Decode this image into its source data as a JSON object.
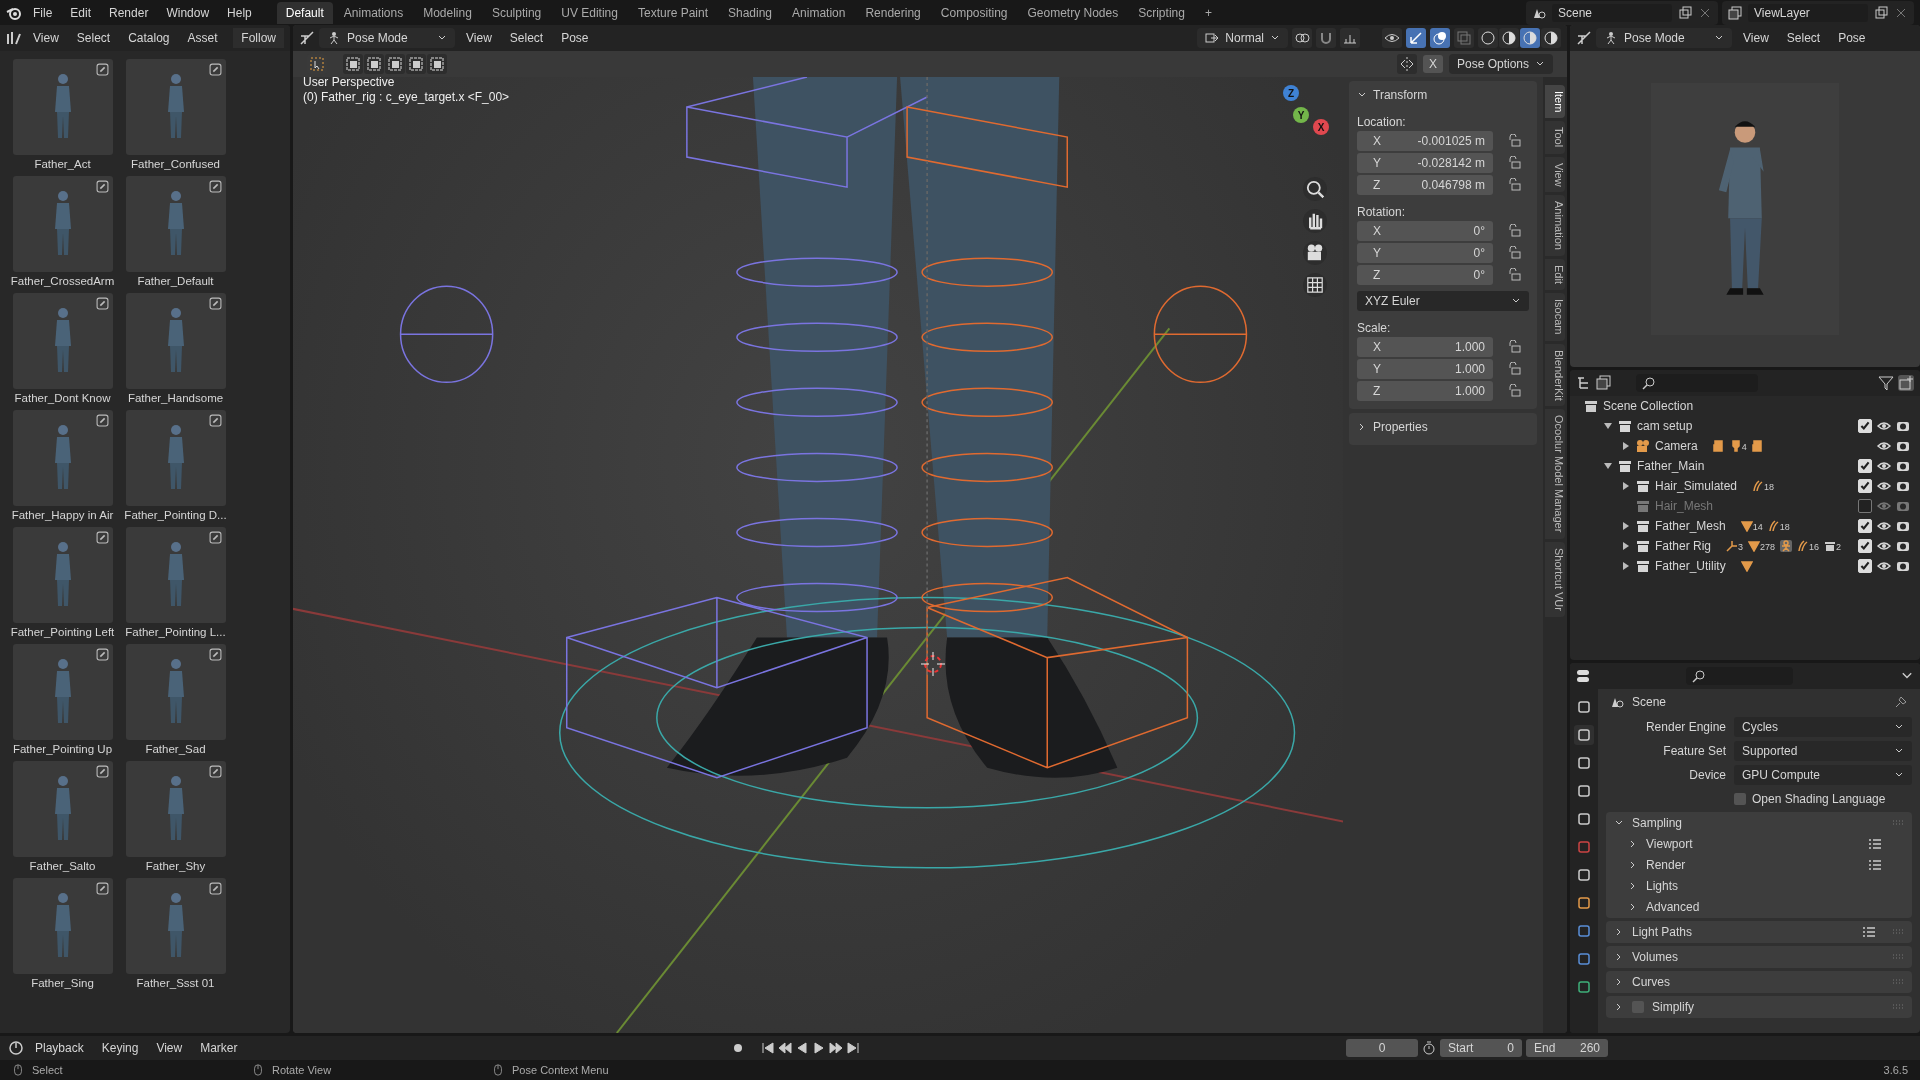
{
  "menu_bar": {
    "items": [
      "File",
      "Edit",
      "Render",
      "Window",
      "Help"
    ]
  },
  "workspace_tabs": [
    {
      "label": "Default",
      "selected": true
    },
    {
      "label": "Animations",
      "selected": false
    },
    {
      "label": "Modeling",
      "selected": false
    },
    {
      "label": "Sculpting",
      "selected": false
    },
    {
      "label": "UV Editing",
      "selected": false
    },
    {
      "label": "Texture Paint",
      "selected": false
    },
    {
      "label": "Shading",
      "selected": false
    },
    {
      "label": "Animation",
      "selected": false
    },
    {
      "label": "Rendering",
      "selected": false
    },
    {
      "label": "Compositing",
      "selected": false
    },
    {
      "label": "Geometry Nodes",
      "selected": false
    },
    {
      "label": "Scripting",
      "selected": false
    },
    {
      "label": "+",
      "selected": false
    }
  ],
  "scene": {
    "name": "Scene"
  },
  "view_layer": {
    "name": "ViewLayer"
  },
  "asset_browser": {
    "menus": [
      "View",
      "Select",
      "Catalog",
      "Asset"
    ],
    "follow": "Follow",
    "assets": [
      {
        "name": "Father_Act"
      },
      {
        "name": "Father_Confused"
      },
      {
        "name": "Father_CrossedArm"
      },
      {
        "name": "Father_Default"
      },
      {
        "name": "Father_Dont Know"
      },
      {
        "name": "Father_Handsome"
      },
      {
        "name": "Father_Happy in Air"
      },
      {
        "name": "Father_Pointing D..."
      },
      {
        "name": "Father_Pointing Left"
      },
      {
        "name": "Father_Pointing L..."
      },
      {
        "name": "Father_Pointing Up"
      },
      {
        "name": "Father_Sad"
      },
      {
        "name": "Father_Salto"
      },
      {
        "name": "Father_Shy"
      },
      {
        "name": "Father_Sing"
      },
      {
        "name": "Father_Ssst 01"
      }
    ]
  },
  "viewport": {
    "mode": "Pose Mode",
    "menus": [
      "View",
      "Select",
      "Pose"
    ],
    "orientation": "Normal",
    "xray": "X",
    "pose_options": "Pose Options",
    "view_name": "User Perspective",
    "active_info": "(0) Father_rig : c_eye_target.x <F_00>",
    "gizmo_axes": [
      "X",
      "Y",
      "Z"
    ],
    "shading_modes": [
      {
        "selected": false
      },
      {
        "selected": false
      },
      {
        "selected": true
      },
      {
        "selected": false
      }
    ]
  },
  "sidebar": {
    "tabs": [
      {
        "label": "Item",
        "selected": true
      },
      {
        "label": "Tool",
        "selected": false
      },
      {
        "label": "View",
        "selected": false
      },
      {
        "label": "Animation",
        "selected": false
      },
      {
        "label": "Edit",
        "selected": false
      },
      {
        "label": "Isocam",
        "selected": false
      },
      {
        "label": "BlenderKit",
        "selected": false
      },
      {
        "label": "Ococlur Model Manager",
        "selected": false
      },
      {
        "label": "Shortcut VUr",
        "selected": false
      }
    ],
    "transform": {
      "title": "Transform",
      "expanded": true,
      "groups": [
        {
          "label": "Location:",
          "fields": [
            {
              "axis": "X",
              "value": "-0.001025 m"
            },
            {
              "axis": "Y",
              "value": "-0.028142 m"
            },
            {
              "axis": "Z",
              "value": "0.046798 m"
            }
          ]
        },
        {
          "label": "Rotation:",
          "fields": [
            {
              "axis": "X",
              "value": "0°"
            },
            {
              "axis": "Y",
              "value": "0°"
            },
            {
              "axis": "Z",
              "value": "0°"
            }
          ]
        },
        {
          "label": "Scale:",
          "fields": [
            {
              "axis": "X",
              "value": "1.000"
            },
            {
              "axis": "Y",
              "value": "1.000"
            },
            {
              "axis": "Z",
              "value": "1.000"
            }
          ]
        }
      ],
      "rotation_mode": "XYZ Euler"
    },
    "properties": {
      "title": "Properties",
      "expanded": false
    }
  },
  "preview": {
    "mode": "Pose Mode",
    "menus": [
      "View",
      "Select",
      "Pose"
    ]
  },
  "outliner": {
    "root": "Scene Collection",
    "items": [
      {
        "name": "cam setup",
        "kind": "collection",
        "expanded": true,
        "checked": true,
        "children": [
          {
            "name": "Camera",
            "kind": "object",
            "expanded": false,
            "badges": [
              {
                "kind": "camera"
              },
              {
                "kind": "light",
                "count": "4"
              },
              {
                "kind": "camera"
              }
            ]
          }
        ]
      },
      {
        "name": "Father_Main",
        "kind": "collection",
        "expanded": true,
        "checked": true,
        "children": [
          {
            "name": "Hair_Simulated",
            "kind": "collection",
            "expanded": false,
            "checked": true,
            "badges": [
              {
                "kind": "hair",
                "count": "18"
              }
            ]
          },
          {
            "name": "Hair_Mesh",
            "kind": "collection",
            "checked": false
          },
          {
            "name": "Father_Mesh",
            "kind": "collection",
            "expanded": false,
            "checked": true,
            "badges": [
              {
                "kind": "mesh",
                "count": "14"
              },
              {
                "kind": "hair",
                "count": "18"
              }
            ]
          },
          {
            "name": "Father Rig",
            "kind": "collection",
            "expanded": false,
            "checked": true,
            "badges": [
              {
                "kind": "armature",
                "count": "3"
              },
              {
                "kind": "mesh",
                "count": "278"
              },
              {
                "kind": "pose"
              },
              {
                "kind": "hair",
                "count": "16"
              },
              {
                "kind": "collection",
                "count": "2"
              }
            ]
          },
          {
            "name": "Father_Utility",
            "kind": "collection",
            "expanded": false,
            "checked": true,
            "badges": [
              {
                "kind": "mesh"
              }
            ]
          }
        ]
      }
    ]
  },
  "properties_editor": {
    "context": "Scene",
    "fields": [
      {
        "label": "Render Engine",
        "value": "Cycles"
      },
      {
        "label": "Feature Set",
        "value": "Supported"
      },
      {
        "label": "Device",
        "value": "GPU Compute"
      }
    ],
    "osl": {
      "label": "Open Shading Language",
      "checked": false
    },
    "panels": [
      {
        "title": "Sampling",
        "expanded": true,
        "presets": false,
        "children": [
          {
            "title": "Viewport",
            "presets": true
          },
          {
            "title": "Render",
            "presets": true
          },
          {
            "title": "Lights",
            "presets": false
          },
          {
            "title": "Advanced",
            "presets": false
          }
        ]
      },
      {
        "title": "Light Paths",
        "expanded": false,
        "presets": true
      },
      {
        "title": "Volumes",
        "expanded": false,
        "presets": false
      },
      {
        "title": "Curves",
        "expanded": false,
        "presets": false
      },
      {
        "title": "Simplify",
        "expanded": false,
        "presets": false,
        "checked": false
      }
    ]
  },
  "timeline": {
    "menus": [
      "Playback",
      "Keying",
      "View",
      "Marker"
    ],
    "frame": "0",
    "start_label": "Start",
    "start": "0",
    "end_label": "End",
    "end": "260"
  },
  "status_bar": {
    "items": [
      "Select",
      "Rotate View",
      "Pose Context Menu"
    ],
    "version": "3.6.5"
  }
}
